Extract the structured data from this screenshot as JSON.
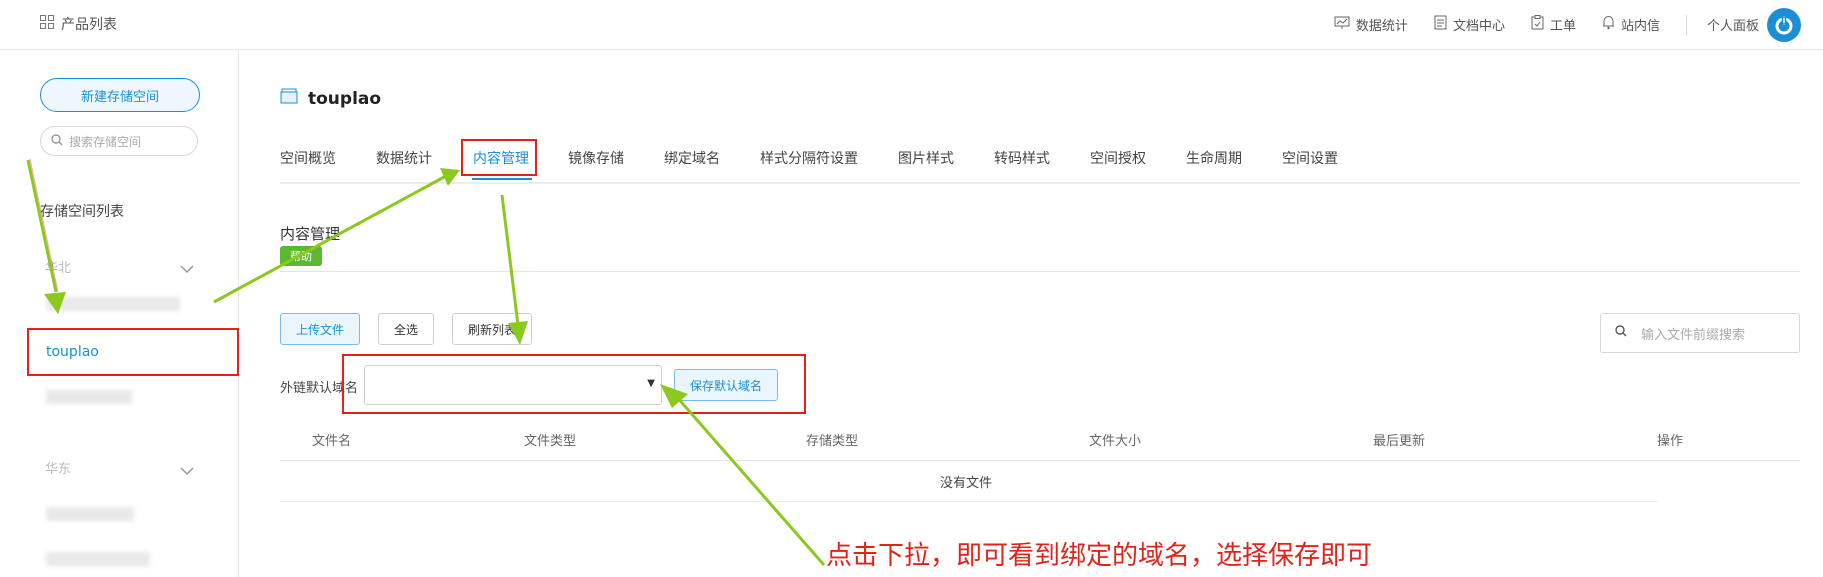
{
  "topbar": {
    "product_list": "产品列表",
    "items": [
      {
        "label": "数据统计",
        "icon": "chart-icon"
      },
      {
        "label": "文档中心",
        "icon": "document-icon"
      },
      {
        "label": "工单",
        "icon": "clipboard-icon"
      },
      {
        "label": "站内信",
        "icon": "bell-icon"
      }
    ],
    "personal_panel": "个人面板"
  },
  "sidebar": {
    "new_space_button": "新建存储空间",
    "search_placeholder": "搜索存储空间",
    "list_title": "存储空间列表",
    "regions": [
      {
        "name": "华北",
        "spaces": [
          "touplao"
        ]
      },
      {
        "name": "华东",
        "spaces": []
      }
    ]
  },
  "main": {
    "space_name": "touplao",
    "tabs": [
      "空间概览",
      "数据统计",
      "内容管理",
      "镜像存储",
      "绑定域名",
      "样式分隔符设置",
      "图片样式",
      "转码样式",
      "空间授权",
      "生命周期",
      "空间设置"
    ],
    "active_tab": "内容管理",
    "section_title": "内容管理",
    "help_badge": "帮助",
    "buttons": {
      "upload": "上传文件",
      "select_all": "全选",
      "refresh": "刷新列表"
    },
    "file_search_placeholder": "输入文件前缀搜索",
    "domain_label": "外链默认域名",
    "domain_value": "",
    "save_domain_button": "保存默认域名",
    "table": {
      "columns": [
        "文件名",
        "文件类型",
        "存储类型",
        "文件大小",
        "最后更新",
        "操作"
      ],
      "empty_text": "没有文件"
    }
  },
  "annotation": {
    "note": "点击下拉，即可看到绑定的域名，选择保存即可",
    "color": "#e2231a",
    "arrow_color": "#8cc91e"
  }
}
